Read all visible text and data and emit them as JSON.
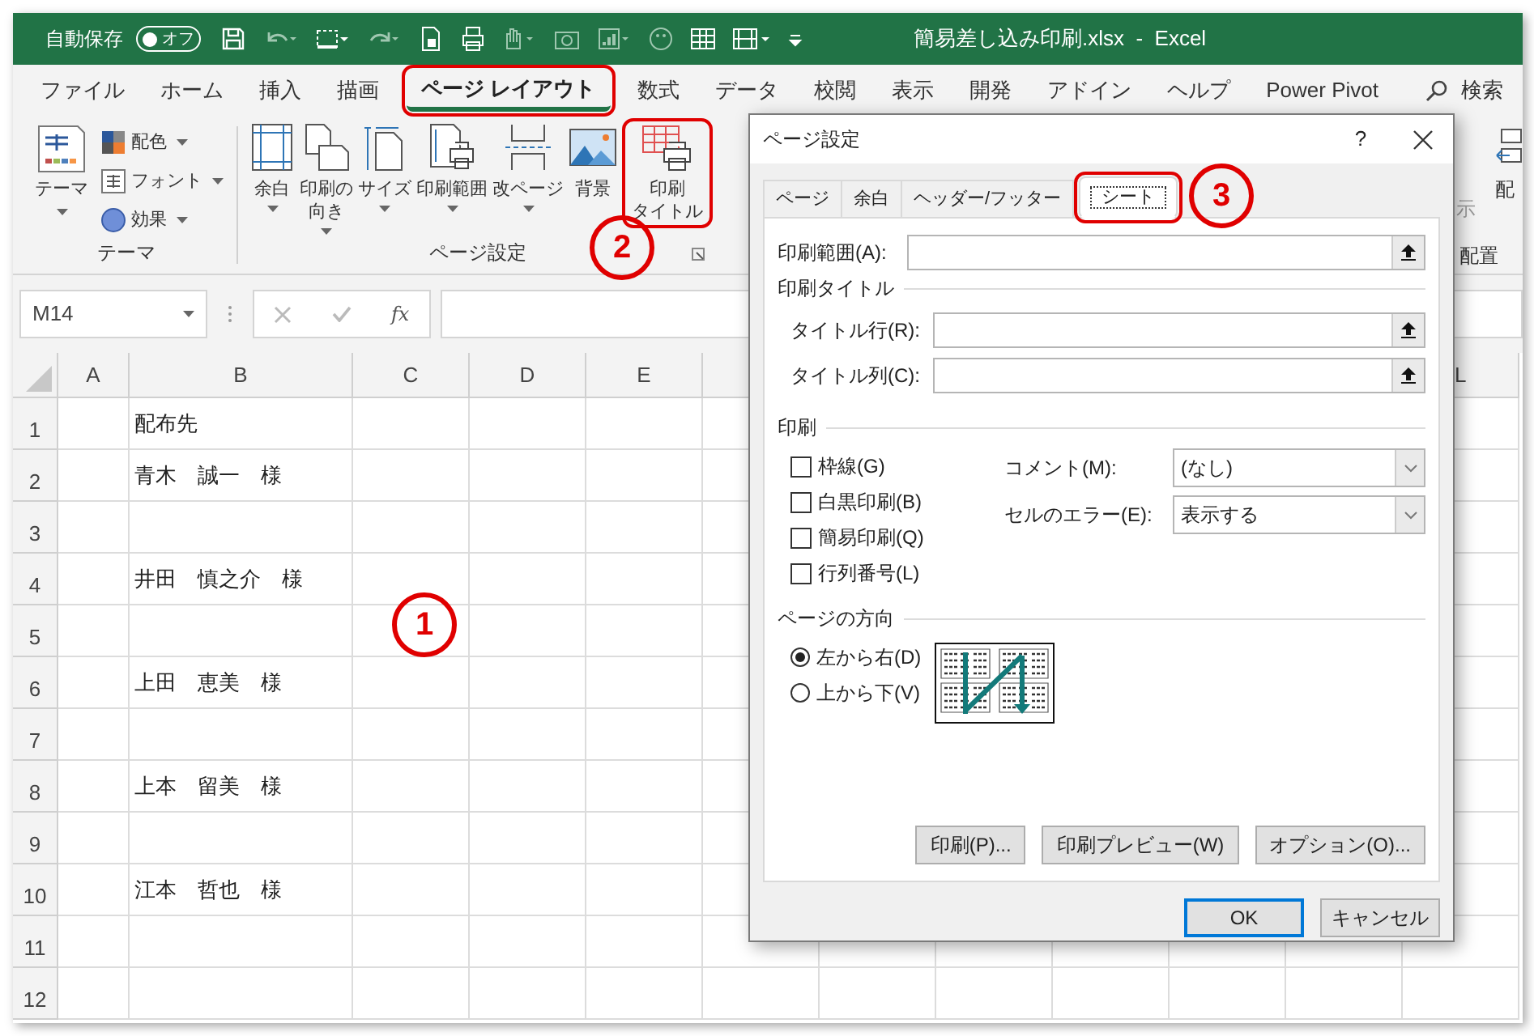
{
  "title_bar": {
    "autosave_label": "自動保存",
    "autosave": {
      "label": "オフ",
      "on": false
    },
    "title": "簡易差し込み印刷.xlsx  -  Excel"
  },
  "menu_tabs": [
    {
      "label": "ファイル",
      "selected": false,
      "highlighted": false
    },
    {
      "label": "ホーム",
      "selected": false,
      "highlighted": false
    },
    {
      "label": "挿入",
      "selected": false,
      "highlighted": false
    },
    {
      "label": "描画",
      "selected": false,
      "highlighted": false
    },
    {
      "label": "ページ レイアウト",
      "selected": true,
      "highlighted": true
    },
    {
      "label": "数式",
      "selected": false,
      "highlighted": false
    },
    {
      "label": "データ",
      "selected": false,
      "highlighted": false
    },
    {
      "label": "校閲",
      "selected": false,
      "highlighted": false
    },
    {
      "label": "表示",
      "selected": false,
      "highlighted": false
    },
    {
      "label": "開発",
      "selected": false,
      "highlighted": false
    },
    {
      "label": "アドイン",
      "selected": false,
      "highlighted": false
    },
    {
      "label": "ヘルプ",
      "selected": false,
      "highlighted": false
    },
    {
      "label": "Power Pivot",
      "selected": false,
      "highlighted": false
    }
  ],
  "search_label": "検索",
  "theme_group": {
    "label": "テーマ",
    "big_button": "テーマ",
    "small_buttons": [
      "配色",
      "フォント",
      "効果"
    ]
  },
  "page_setup_group": {
    "label": "ページ設定",
    "buttons": [
      {
        "label": "余白",
        "menu": true,
        "highlighted": false
      },
      {
        "lines": [
          "印刷の",
          "向き"
        ],
        "menu": true,
        "highlighted": false
      },
      {
        "label": "サイズ",
        "menu": true,
        "highlighted": false
      },
      {
        "label": "印刷範囲",
        "menu": true,
        "highlighted": false
      },
      {
        "label": "改ページ",
        "menu": true,
        "highlighted": false
      },
      {
        "label": "背景",
        "menu": false,
        "highlighted": false
      },
      {
        "lines": [
          "印刷",
          "タイトル"
        ],
        "menu": false,
        "highlighted": true
      }
    ]
  },
  "partial_ribbon": {
    "button_label": "示",
    "button2_label": "配",
    "group_label": "配置"
  },
  "formula_bar": {
    "name_box": "M14",
    "function_label": "fx"
  },
  "sheet": {
    "columns": [
      "A",
      "B",
      "C",
      "D",
      "E"
    ],
    "column_far": "L",
    "rows": [
      {
        "number": "1",
        "column_b": "配布先"
      },
      {
        "number": "2",
        "column_b": "青木　誠一　様"
      },
      {
        "number": "3"
      },
      {
        "number": "4",
        "column_b": "井田　慎之介　様"
      },
      {
        "number": "5"
      },
      {
        "number": "6",
        "column_b": "上田　恵美　様"
      },
      {
        "number": "7"
      },
      {
        "number": "8",
        "column_b": "上本　留美　様"
      },
      {
        "number": "9"
      },
      {
        "number": "10",
        "column_b": "江本　哲也　様"
      },
      {
        "number": "11"
      },
      {
        "number": "12"
      }
    ]
  },
  "dialog": {
    "title": "ページ設定",
    "help": "?",
    "tabs": [
      {
        "label": "ページ",
        "selected": false,
        "highlighted": false
      },
      {
        "label": "余白",
        "selected": false,
        "highlighted": false
      },
      {
        "label": "ヘッダー/フッター",
        "selected": false,
        "highlighted": false
      },
      {
        "label": "シート",
        "selected": true,
        "highlighted": true
      }
    ],
    "print_area": {
      "label": "印刷範囲(A):"
    },
    "print_titles": {
      "heading": "印刷タイトル",
      "fields": [
        {
          "label": "タイトル行(R):"
        },
        {
          "label": "タイトル列(C):"
        }
      ]
    },
    "print": {
      "heading": "印刷",
      "options": [
        {
          "label": "枠線(G)",
          "checked": false
        },
        {
          "label": "白黒印刷(B)",
          "checked": false
        },
        {
          "label": "簡易印刷(Q)",
          "checked": false
        },
        {
          "label": "行列番号(L)",
          "checked": false
        }
      ],
      "dropdowns": [
        {
          "label": "コメント(M):",
          "value": "(なし)"
        },
        {
          "label": "セルのエラー(E):",
          "value": "表示する"
        }
      ]
    },
    "page_order": {
      "heading": "ページの方向",
      "options": [
        {
          "label": "左から右(D)",
          "selected": true
        },
        {
          "label": "上から下(V)",
          "selected": false
        }
      ]
    },
    "panel_buttons": [
      "印刷(P)...",
      "印刷プレビュー(W)",
      "オプション(O)..."
    ],
    "buttons": [
      {
        "label": "OK",
        "default": true
      },
      {
        "label": "キャンセル",
        "default": false
      }
    ]
  },
  "annotations": [
    {
      "label": "1"
    },
    {
      "label": "2"
    },
    {
      "label": "3"
    }
  ]
}
